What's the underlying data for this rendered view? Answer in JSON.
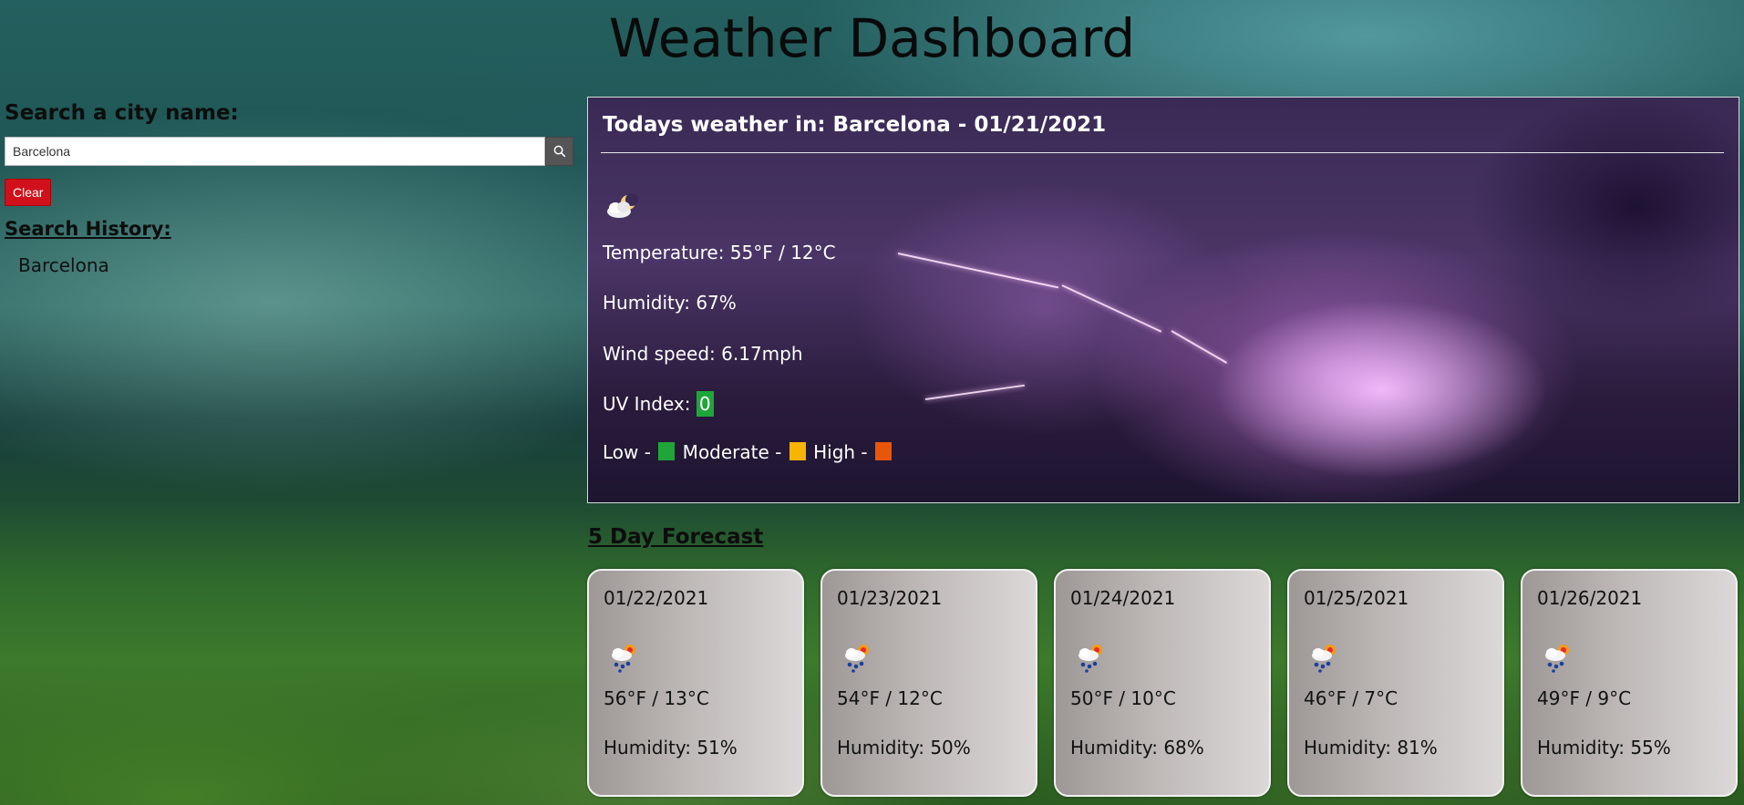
{
  "app": {
    "title": "Weather Dashboard"
  },
  "sidebar": {
    "search_heading": "Search a city name:",
    "search_value": "Barcelona",
    "search_icon": "search-icon",
    "clear_label": "Clear",
    "history_heading": "Search History:",
    "history": [
      "Barcelona"
    ]
  },
  "today": {
    "title": "Todays weather in: Barcelona - 01/21/2021",
    "icon": "partly-cloudy-night-icon",
    "temperature": "Temperature: 55°F / 12°C",
    "humidity": "Humidity: 67%",
    "wind": "Wind speed: 6.17mph",
    "uv_label": "UV Index: ",
    "uv_value": "0",
    "legend": {
      "low": "Low - ",
      "moderate": " Moderate - ",
      "high": " High - "
    }
  },
  "forecast": {
    "heading": "5 Day Forecast",
    "icon": "rain-sun-cloud-icon",
    "days": [
      {
        "date": "01/22/2021",
        "temp": "56°F / 13°C",
        "humidity": "Humidity: 51%"
      },
      {
        "date": "01/23/2021",
        "temp": "54°F / 12°C",
        "humidity": "Humidity: 50%"
      },
      {
        "date": "01/24/2021",
        "temp": "50°F / 10°C",
        "humidity": "Humidity: 68%"
      },
      {
        "date": "01/25/2021",
        "temp": "46°F / 7°C",
        "humidity": "Humidity: 81%"
      },
      {
        "date": "01/26/2021",
        "temp": "49°F / 9°C",
        "humidity": "Humidity: 55%"
      }
    ]
  },
  "colors": {
    "uv_low": "#1fa53a",
    "uv_moderate": "#f7b500",
    "uv_high": "#e8560a",
    "clear_button": "#d0101a"
  }
}
